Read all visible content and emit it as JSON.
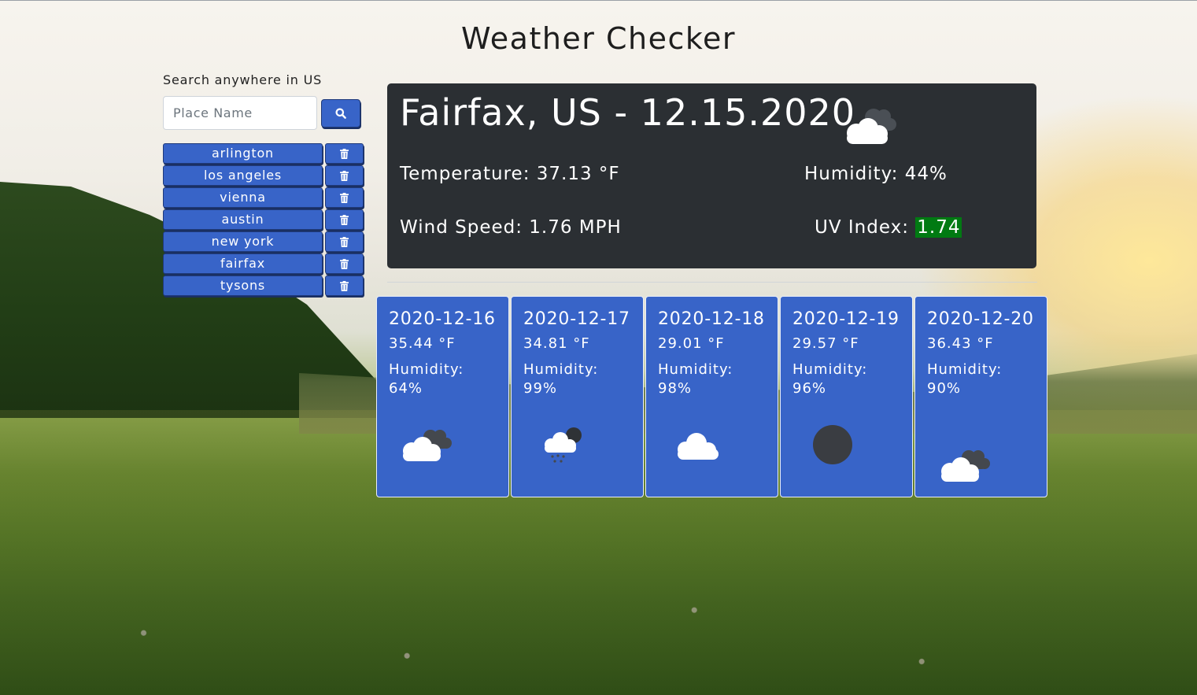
{
  "page": {
    "title": "Weather Checker"
  },
  "search": {
    "label": "Search anywhere in US",
    "placeholder": "Place Name",
    "value": "",
    "button_icon": "search-icon"
  },
  "history": [
    {
      "city": "arlington",
      "delete_icon": "trash-icon"
    },
    {
      "city": "los angeles",
      "delete_icon": "trash-icon"
    },
    {
      "city": "vienna",
      "delete_icon": "trash-icon"
    },
    {
      "city": "austin",
      "delete_icon": "trash-icon"
    },
    {
      "city": "new york",
      "delete_icon": "trash-icon"
    },
    {
      "city": "fairfax",
      "delete_icon": "trash-icon"
    },
    {
      "city": "tysons",
      "delete_icon": "trash-icon"
    }
  ],
  "current": {
    "heading": "Fairfax, US - 12.15.2020",
    "icon": "broken-clouds-icon",
    "temperature_label": "Temperature: ",
    "temperature": "37.13 °F",
    "humidity_label": "Humidity: ",
    "humidity": "44%",
    "wind_label": "Wind Speed: ",
    "wind": "1.76 MPH",
    "uv_label": "UV Index: ",
    "uv": "1.74",
    "uv_color": "#007a12"
  },
  "forecast": [
    {
      "date": "2020-12-16",
      "temp": "35.44 °F",
      "humidity_label": "Humidity:",
      "humidity": "64%",
      "icon": "broken-clouds-icon"
    },
    {
      "date": "2020-12-17",
      "temp": "34.81 °F",
      "humidity_label": "Humidity:",
      "humidity": "99%",
      "icon": "snow-rain-cloud-icon"
    },
    {
      "date": "2020-12-18",
      "temp": "29.01 °F",
      "humidity_label": "Humidity:",
      "humidity": "98%",
      "icon": "cloud-icon"
    },
    {
      "date": "2020-12-19",
      "temp": "29.57 °F",
      "humidity_label": "Humidity:",
      "humidity": "96%",
      "icon": "clear-night-icon"
    },
    {
      "date": "2020-12-20",
      "temp": "36.43 °F",
      "humidity_label": "Humidity:",
      "humidity": "90%",
      "icon": "broken-clouds-icon"
    }
  ],
  "colors": {
    "accent": "#3864c8",
    "current_panel": "#2b2f33",
    "uv_low": "#007a12"
  }
}
